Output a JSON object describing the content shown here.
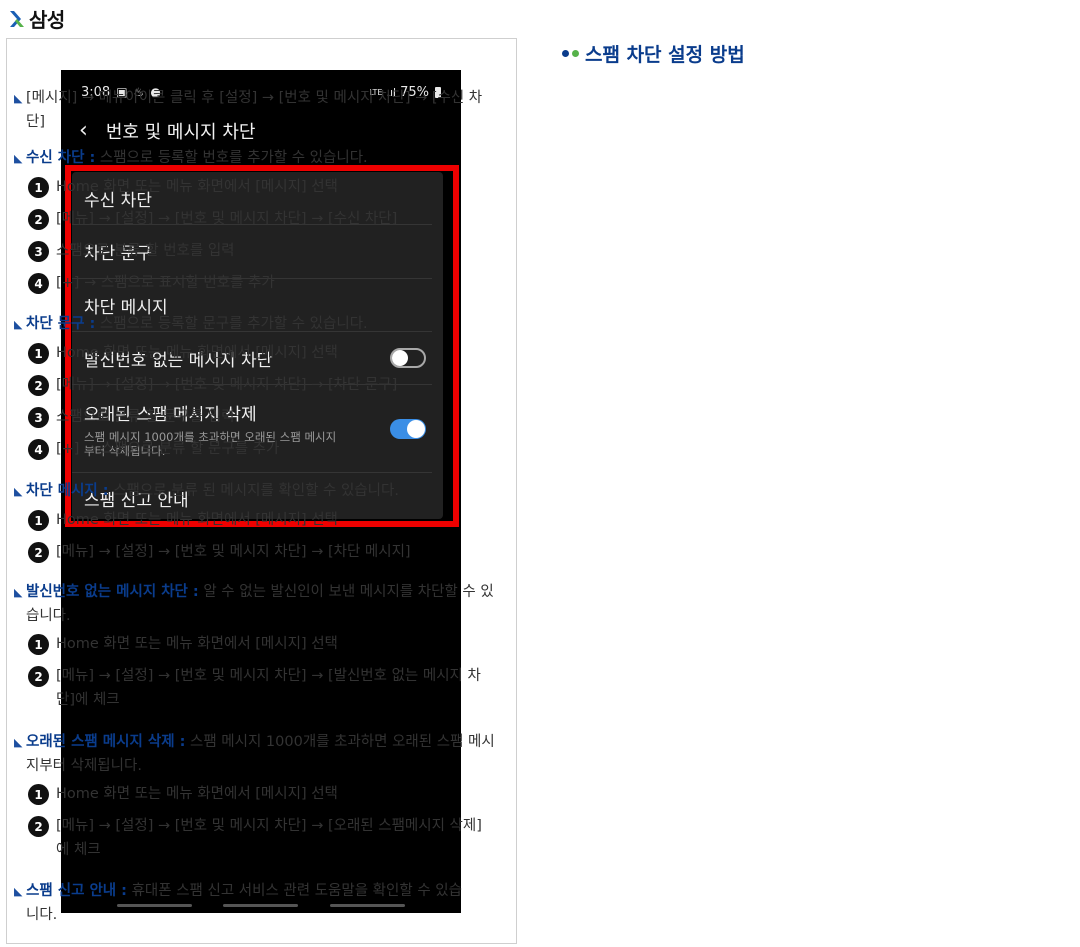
{
  "brand": {
    "name": "삼성"
  },
  "phone": {
    "status_time": "3:08",
    "status_network": "LTE",
    "status_battery": "75%",
    "screen_title": "번호 및 메시지 차단",
    "rows": [
      {
        "label": "수신 차단"
      },
      {
        "label": "차단 문구"
      },
      {
        "label": "차단 메시지"
      },
      {
        "label": "발신번호 없는 메시지 차단",
        "toggle": "off"
      },
      {
        "label": "오래된 스팸 메시지 삭제",
        "sub": "스팸 메시지 1000개를 초과하면 오래된 스팸 메시지부터 삭제됩니다.",
        "toggle": "on"
      },
      {
        "label": "스팸 신고 안내"
      }
    ]
  },
  "guide": {
    "title": "스팸 차단 설정 방법",
    "intro": "[메시지] → 메뉴아이콘 클릭 후 [설정] → [번호 및 메시지 차단] → [수신 차단]",
    "sections": [
      {
        "keyword": "수신 차단 :",
        "desc": " 스팸으로 등록할 번호를 추가할 수 있습니다.",
        "steps": [
          "Home 화면 또는 메뉴 화면에서 [메시지] 선택",
          "[메뉴] → [설정] → [번호 및 메시지 차단] → [수신 차단]",
          "스팸으로 분류 할 번호를 입력",
          "[+] → 스팸으로 표시할 번호를 추가"
        ]
      },
      {
        "keyword": "차단 문구 :",
        "desc": " 스팸으로 등록할 문구를 추가할 수 있습니다.",
        "steps": [
          "Home 화면 또는 메뉴 화면에서 [메시지] 선택",
          "[메뉴] → [설정] → [번호 및 메시지 차단] → [차단 문구]",
          "스팸으로 분류 할 문구를 입력",
          "[+] → 스팸으로 분류 할 문구를 추가"
        ]
      },
      {
        "keyword": "차단 메시지 :",
        "desc": " 스팸으로 분류 된 메시지를 확인할 수 있습니다.",
        "steps": [
          "Home 화면 또는 메뉴 화면에서 [메시지] 선택",
          "[메뉴] → [설정] → [번호 및 메시지 차단] → [차단 메시지]"
        ]
      },
      {
        "keyword": "발신번호 없는 메시지 차단 :",
        "desc": " 알 수 없는 발신인이 보낸 메시지를 차단할 수 있습니다.",
        "steps": [
          "Home 화면 또는 메뉴 화면에서 [메시지] 선택",
          "[메뉴] → [설정] → [번호 및 메시지 차단] → [발신번호 없는 메시지 차단]에 체크"
        ]
      },
      {
        "keyword": "오래된 스팸 메시지 삭제 :",
        "desc": " 스팸 메시지 1000개를 초과하면 오래된 스팸 메시지부터 삭제됩니다.",
        "steps": [
          "Home 화면 또는 메뉴 화면에서 [메시지] 선택",
          "[메뉴] → [설정] → [번호 및 메시지 차단] → [오래된 스팸메시지 삭제]에 체크"
        ]
      },
      {
        "keyword": "스팸 신고 안내 :",
        "desc": " 휴대폰 스팸 신고 서비스 관련 도움말을 확인할 수 있습니다.",
        "steps": []
      }
    ]
  },
  "colors": {
    "keyword": "#0a3c8c",
    "accent_green": "#56b24a",
    "highlight_red": "#ee0000",
    "toggle_on": "#3a8ee6"
  }
}
